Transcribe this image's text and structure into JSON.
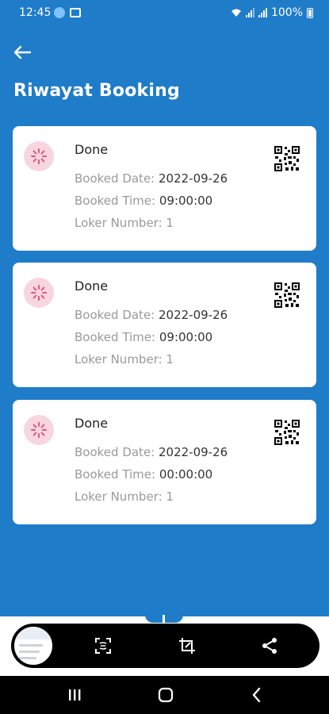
{
  "status_bar": {
    "time": "12:45",
    "battery": "100%",
    "icons": [
      "google-circle-icon",
      "gallery-icon",
      "wifi-icon",
      "signal-icon",
      "signal-icon",
      "battery-icon"
    ]
  },
  "header": {
    "title": "Riwayat Booking",
    "back_icon": "arrow-left-icon"
  },
  "labels": {
    "booked_date": "Booked Date: ",
    "booked_time": "Booked Time: ",
    "loker_number": "Loker Number: "
  },
  "bookings": [
    {
      "status": "Done",
      "booked_date": "2022-09-26",
      "booked_time": "09:00:00",
      "loker_number": "1"
    },
    {
      "status": "Done",
      "booked_date": "2022-09-26",
      "booked_time": "09:00:00",
      "loker_number": "1"
    },
    {
      "status": "Done",
      "booked_date": "2022-09-26",
      "booked_time": "00:00:00",
      "loker_number": "1"
    }
  ],
  "toolbar": {
    "icons": [
      "screenshot-thumbnail",
      "scan-text-icon",
      "crop-edit-icon",
      "share-icon"
    ]
  },
  "navbar": {
    "icons": [
      "recent-apps-icon",
      "home-icon",
      "back-icon"
    ]
  },
  "colors": {
    "primary": "#1f7cc9",
    "card": "#ffffff",
    "status_icon_bg": "#f7d6df",
    "status_icon_fg": "#e0567a"
  }
}
